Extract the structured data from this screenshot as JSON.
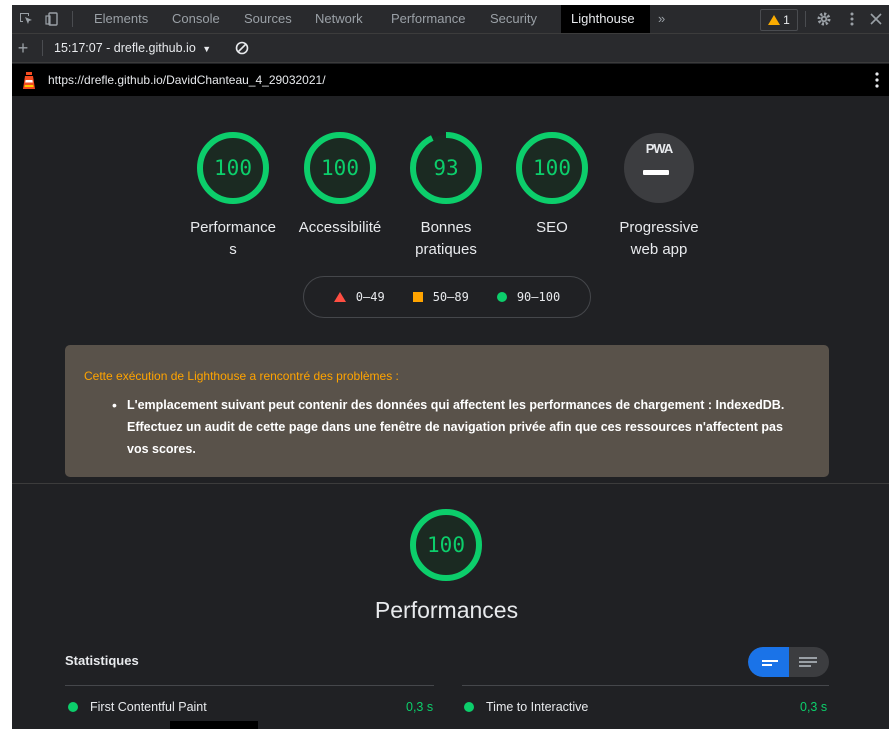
{
  "devtools": {
    "tabs": [
      "Elements",
      "Console",
      "Sources",
      "Network",
      "Performance",
      "Security",
      "Lighthouse"
    ],
    "active_tab": "Lighthouse",
    "more_tabs_glyph": "»",
    "warning_count": "1"
  },
  "report_bar": {
    "new_report_glyph": "+",
    "selector_label": "15:17:07 - drefle.github.io",
    "dropdown_glyph": "▼",
    "clear_glyph": "⊘"
  },
  "url_bar": {
    "url": "https://drefle.github.io/DavidChanteau_4_29032021/"
  },
  "gauges": [
    {
      "score": "100",
      "value": 100,
      "label": "Performances"
    },
    {
      "score": "100",
      "value": 100,
      "label": "Accessibilité"
    },
    {
      "score": "93",
      "value": 93,
      "label": "Bonnes pratiques"
    },
    {
      "score": "100",
      "value": 100,
      "label": "SEO"
    },
    {
      "score": "PWA",
      "label": "Progressive web app"
    }
  ],
  "legend": {
    "fail": "0–49",
    "average": "50–89",
    "pass": "90–100"
  },
  "warning": {
    "title": "Cette exécution de Lighthouse a rencontré des problèmes :",
    "item": "L'emplacement suivant peut contenir des données qui affectent les performances de chargement : IndexedDB. Effectuez un audit de cette page dans une fenêtre de navigation privée afin que ces ressources n'affectent pas vos scores."
  },
  "performance": {
    "score": "100",
    "value": 100,
    "title": "Performances",
    "stats_title": "Statistiques",
    "metrics": [
      {
        "name": "First Contentful Paint",
        "value": "0,3 s"
      },
      {
        "name": "Time to Interactive",
        "value": "0,3 s"
      }
    ]
  },
  "colors": {
    "pass": "#0cce6b",
    "average": "#ffa400",
    "fail": "#ff4e42",
    "accent": "#1a73e8"
  }
}
